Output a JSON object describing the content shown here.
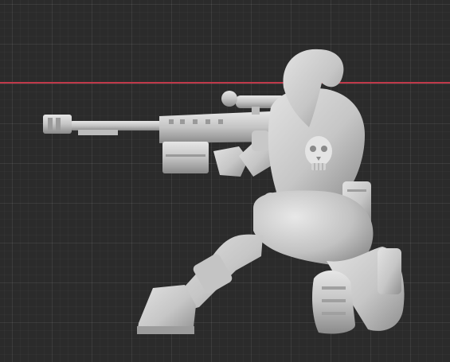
{
  "viewport": {
    "background": "#2b2b2b",
    "grid_color": "#3a3a3a",
    "x_axis_color": "#c0394a"
  },
  "model": {
    "icon": "sniper-miniature-model",
    "fill_light": "#d2d2d2",
    "fill_mid": "#b9b9b9",
    "fill_dark": "#8e8e8e"
  }
}
